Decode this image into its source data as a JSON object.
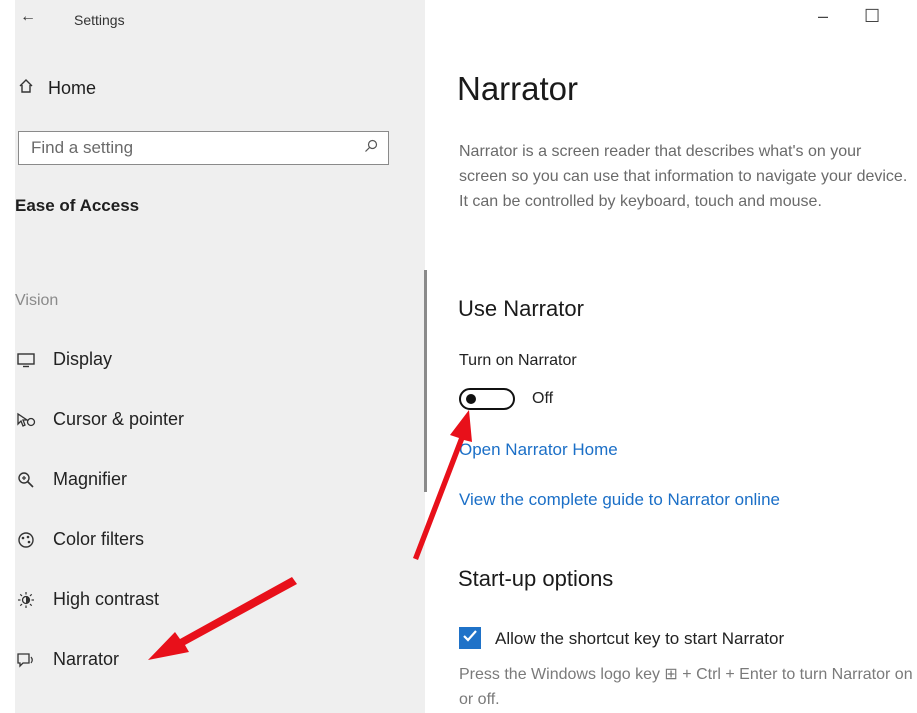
{
  "window": {
    "back_glyph": "←",
    "title": "Settings",
    "minimize_glyph": "–",
    "maximize_glyph": "☐"
  },
  "sidebar": {
    "home": {
      "icon": "home-icon",
      "label": "Home"
    },
    "search": {
      "placeholder": "Find a setting",
      "icon": "search-icon"
    },
    "section_title": "Ease of Access",
    "category": "Vision",
    "items": [
      {
        "icon": "display-icon",
        "label": "Display"
      },
      {
        "icon": "cursor-icon",
        "label": "Cursor & pointer"
      },
      {
        "icon": "magnifier-icon",
        "label": "Magnifier"
      },
      {
        "icon": "color-filters-icon",
        "label": "Color filters"
      },
      {
        "icon": "high-contrast-icon",
        "label": "High contrast"
      },
      {
        "icon": "narrator-icon",
        "label": "Narrator"
      }
    ]
  },
  "main": {
    "title": "Narrator",
    "description": "Narrator is a screen reader that describes what's on your screen so you can use that information to navigate your device. It can be controlled by keyboard, touch and mouse.",
    "use_narrator": {
      "heading": "Use Narrator",
      "toggle_label": "Turn on Narrator",
      "toggle_state": "Off",
      "links": [
        "Open Narrator Home",
        "View the complete guide to Narrator online"
      ]
    },
    "startup": {
      "heading": "Start-up options",
      "checkbox_label": "Allow the shortcut key to start Narrator",
      "checked": true,
      "note": "Press the Windows logo key ⊞ + Ctrl + Enter to turn Narrator on or off."
    }
  },
  "colors": {
    "accent": "#1f72c8",
    "link": "#1b6fc7",
    "annotation_arrow": "#e8101a"
  }
}
